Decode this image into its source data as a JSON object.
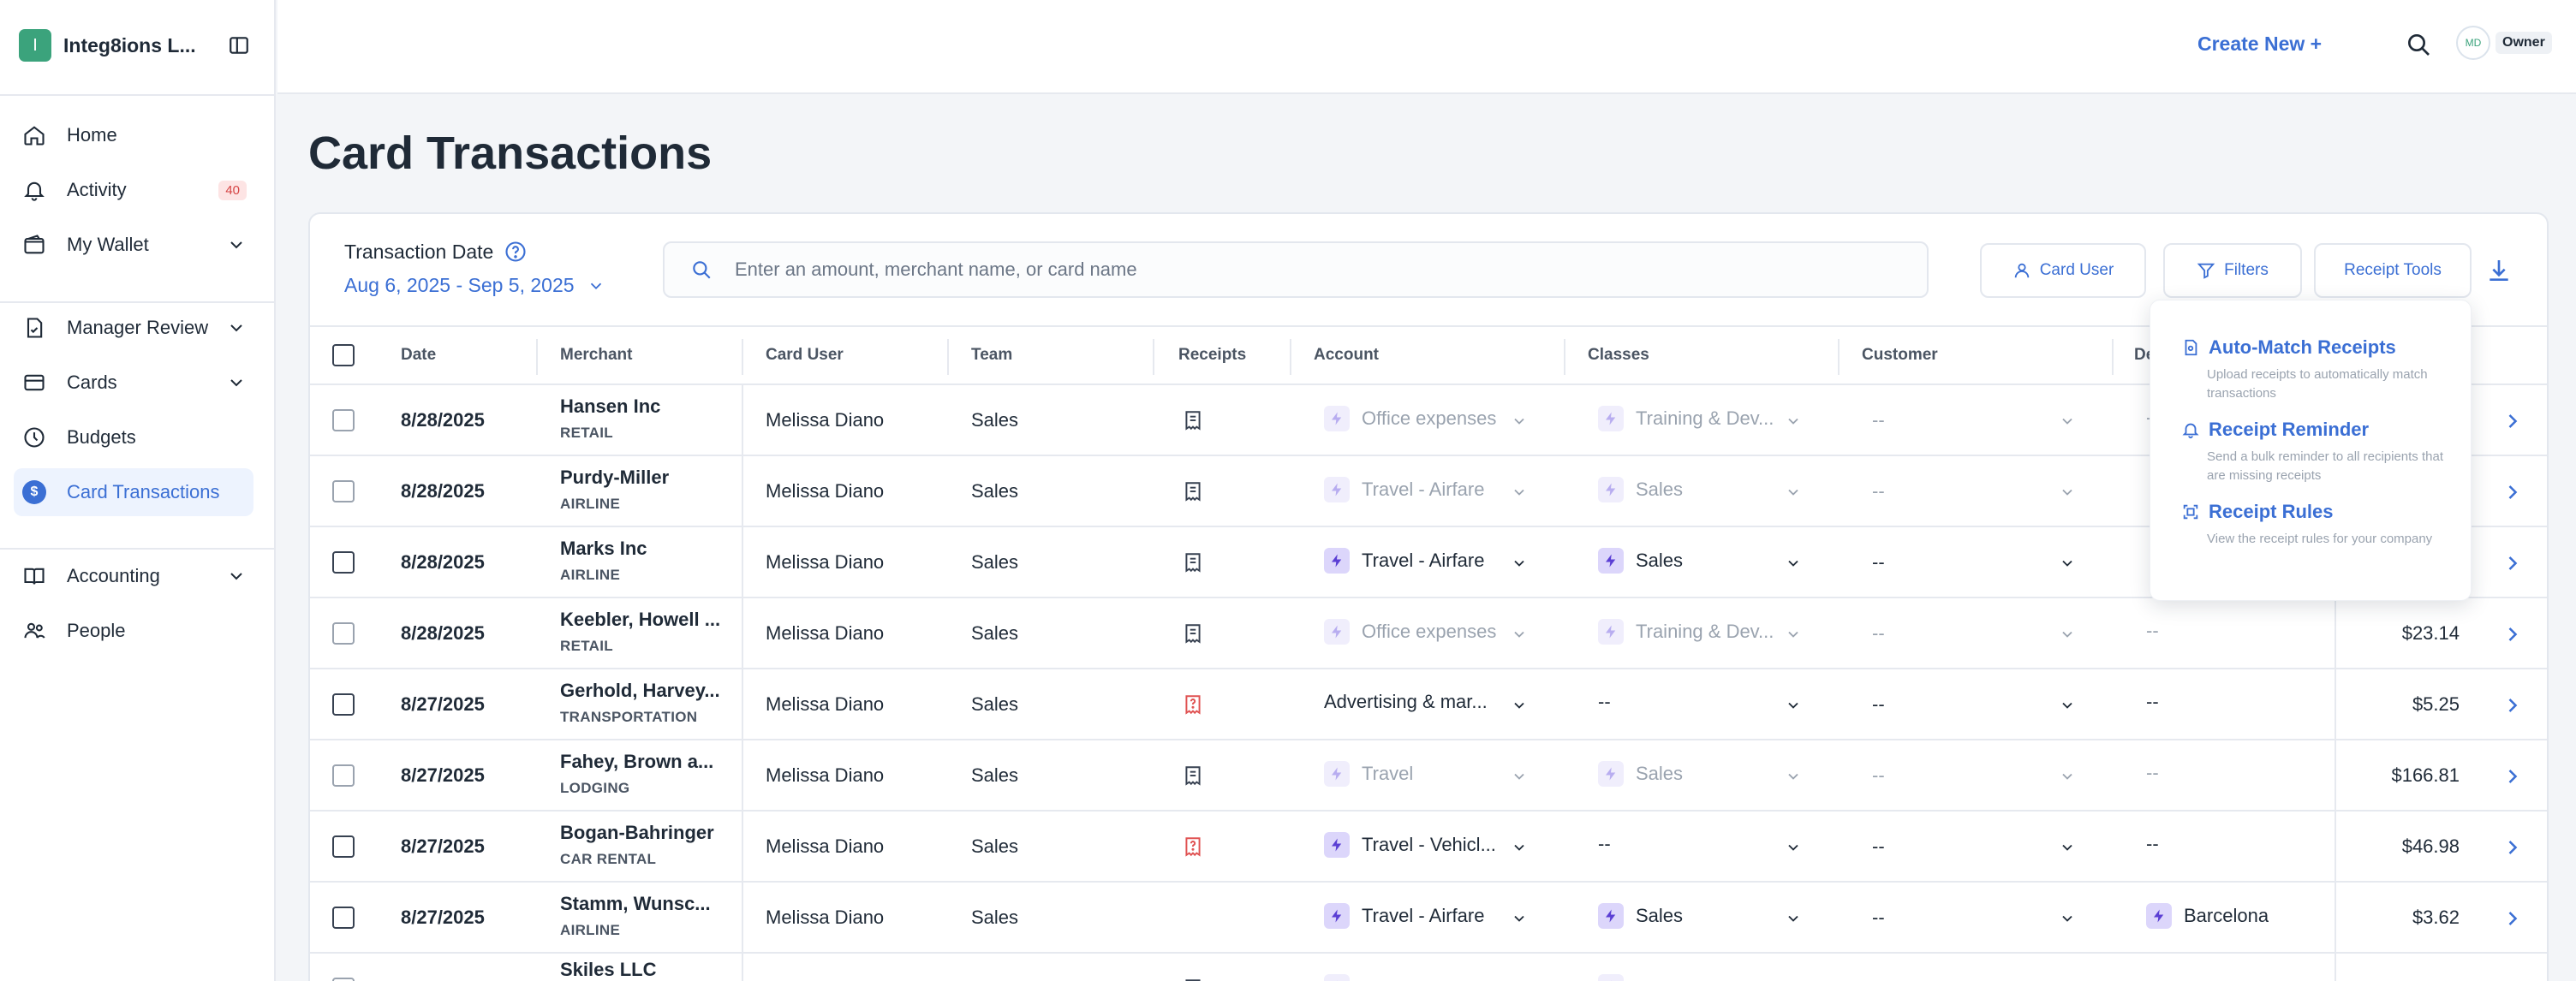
{
  "org": {
    "initial": "I",
    "name": "Integ8ions L..."
  },
  "nav": {
    "home": "Home",
    "activity": "Activity",
    "activity_badge": "40",
    "wallet": "My Wallet",
    "manager_review": "Manager Review",
    "cards": "Cards",
    "budgets": "Budgets",
    "card_transactions": "Card Transactions",
    "accounting": "Accounting",
    "people": "People"
  },
  "header": {
    "create_new": "Create New +",
    "user_initials": "MD",
    "role": "Owner"
  },
  "page": {
    "title": "Card Transactions"
  },
  "filters": {
    "date_label": "Transaction Date",
    "date_range": "Aug 6, 2025 - Sep 5, 2025",
    "search_placeholder": "Enter an amount, merchant name, or card name",
    "card_user": "Card User",
    "filters": "Filters",
    "receipt_tools": "Receipt Tools"
  },
  "table": {
    "headers": {
      "date": "Date",
      "merchant": "Merchant",
      "card_user": "Card User",
      "team": "Team",
      "receipts": "Receipts",
      "account": "Account",
      "classes": "Classes",
      "customer": "Customer",
      "department": "De"
    },
    "rows": [
      {
        "date": "8/28/2025",
        "merchant": "Hansen Inc",
        "category": "RETAIL",
        "user": "Melissa Diano",
        "team": "Sales",
        "receipt": "ok",
        "account": "Office expenses",
        "account_state": "dim",
        "class": "Training & Dev...",
        "class_state": "dim",
        "customer": "--",
        "dept": "--",
        "amount": ""
      },
      {
        "date": "8/28/2025",
        "merchant": "Purdy-Miller",
        "category": "AIRLINE",
        "user": "Melissa Diano",
        "team": "Sales",
        "receipt": "ok",
        "account": "Travel - Airfare",
        "account_state": "dim",
        "class": "Sales",
        "class_state": "dim",
        "customer": "--",
        "dept": "",
        "amount": ""
      },
      {
        "date": "8/28/2025",
        "merchant": "Marks Inc",
        "category": "AIRLINE",
        "user": "Melissa Diano",
        "team": "Sales",
        "receipt": "ok",
        "account": "Travel - Airfare",
        "account_state": "on",
        "class": "Sales",
        "class_state": "on",
        "customer": "--",
        "dept": "",
        "amount": ""
      },
      {
        "date": "8/28/2025",
        "merchant": "Keebler, Howell ...",
        "category": "RETAIL",
        "user": "Melissa Diano",
        "team": "Sales",
        "receipt": "ok",
        "account": "Office expenses",
        "account_state": "dim",
        "class": "Training & Dev...",
        "class_state": "dim",
        "customer": "--",
        "dept": "--",
        "amount": "$23.14"
      },
      {
        "date": "8/27/2025",
        "merchant": "Gerhold, Harvey...",
        "category": "TRANSPORTATION",
        "user": "Melissa Diano",
        "team": "Sales",
        "receipt": "missing",
        "account": "Advertising & mar...",
        "account_state": "plain",
        "class": "--",
        "class_state": "plain",
        "customer": "--",
        "dept": "--",
        "amount": "$5.25"
      },
      {
        "date": "8/27/2025",
        "merchant": "Fahey, Brown a...",
        "category": "LODGING",
        "user": "Melissa Diano",
        "team": "Sales",
        "receipt": "ok",
        "account": "Travel",
        "account_state": "dim",
        "class": "Sales",
        "class_state": "dim",
        "customer": "--",
        "dept": "--",
        "amount": "$166.81"
      },
      {
        "date": "8/27/2025",
        "merchant": "Bogan-Bahringer",
        "category": "CAR RENTAL",
        "user": "Melissa Diano",
        "team": "Sales",
        "receipt": "missing",
        "account": "Travel - Vehicl...",
        "account_state": "on",
        "class": "--",
        "class_state": "plain",
        "customer": "--",
        "dept": "--",
        "amount": "$46.98"
      },
      {
        "date": "8/27/2025",
        "merchant": "Stamm, Wunsc...",
        "category": "AIRLINE",
        "user": "Melissa Diano",
        "team": "Sales",
        "receipt": "none",
        "account": "Travel - Airfare",
        "account_state": "on",
        "class": "Sales",
        "class_state": "on",
        "customer": "--",
        "dept": "Barcelona",
        "amount": "$3.62"
      },
      {
        "date": "",
        "merchant": "Skiles LLC",
        "category": "",
        "user": "",
        "team": "",
        "receipt": "ok",
        "account": "",
        "account_state": "dim",
        "class": "",
        "class_state": "dim",
        "customer": "",
        "dept": "",
        "amount": ""
      }
    ]
  },
  "receipt_tools_menu": {
    "auto_match_title": "Auto-Match Receipts",
    "auto_match_desc": "Upload receipts to automatically match transactions",
    "reminder_title": "Receipt Reminder",
    "reminder_desc": "Send a bulk reminder to all recipients that are missing receipts",
    "rules_title": "Receipt Rules",
    "rules_desc": "View the receipt rules for your company"
  },
  "colors": {
    "accent": "#3b6fd4",
    "brand": "#3ba37c",
    "missing": "#e05252"
  }
}
